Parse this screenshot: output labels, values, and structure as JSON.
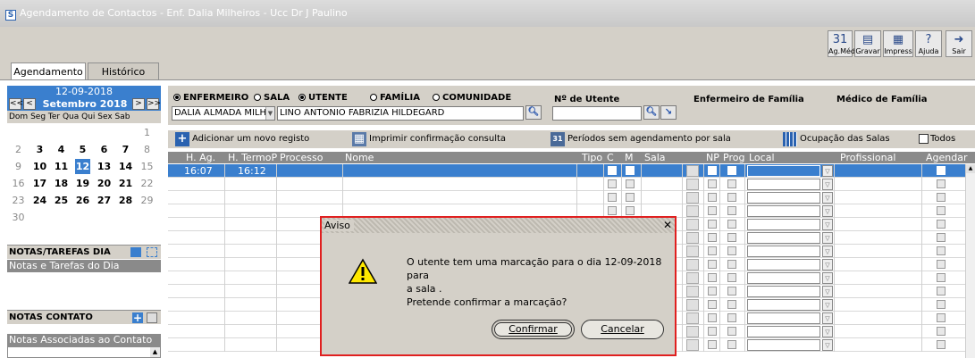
{
  "window": {
    "title": "Agendamento de Contactos - Enf. Dalia Milheiros - Ucc Dr J Paulino",
    "logo_letter": "S"
  },
  "toolbar": [
    {
      "name": "ag-med-button",
      "label": "Ag.Méd.",
      "icon": "calendar-icon",
      "glyph": "31"
    },
    {
      "name": "gravar-button",
      "label": "Gravar",
      "icon": "save-icon",
      "glyph": "▤"
    },
    {
      "name": "impress-button",
      "label": "Impress",
      "icon": "printer-icon",
      "glyph": "▦"
    },
    {
      "name": "ajuda-button",
      "label": "Ajuda",
      "icon": "help-icon",
      "glyph": "?"
    },
    {
      "name": "sair-button",
      "label": "Sair",
      "icon": "exit-icon",
      "glyph": "➜"
    }
  ],
  "tabs": [
    {
      "label": "Agendamento",
      "active": true
    },
    {
      "label": "Histórico",
      "active": false
    }
  ],
  "calendar": {
    "date": "12-09-2018",
    "month": "Setembro 2018",
    "nav": {
      "prev_year": "<<",
      "prev": "<",
      "next": ">",
      "next_year": ">>"
    },
    "weekdays": "Dom Seg Ter Qua Qui Sex Sab",
    "days": [
      {
        "d": "1",
        "row": 0,
        "col": 6,
        "dim": true
      },
      {
        "d": "2",
        "row": 1,
        "col": 0,
        "dim": true
      },
      {
        "d": "3",
        "row": 1,
        "col": 1
      },
      {
        "d": "4",
        "row": 1,
        "col": 2
      },
      {
        "d": "5",
        "row": 1,
        "col": 3
      },
      {
        "d": "6",
        "row": 1,
        "col": 4
      },
      {
        "d": "7",
        "row": 1,
        "col": 5
      },
      {
        "d": "8",
        "row": 1,
        "col": 6,
        "dim": true
      },
      {
        "d": "9",
        "row": 2,
        "col": 0,
        "dim": true
      },
      {
        "d": "10",
        "row": 2,
        "col": 1
      },
      {
        "d": "11",
        "row": 2,
        "col": 2
      },
      {
        "d": "12",
        "row": 2,
        "col": 3,
        "selected": true
      },
      {
        "d": "13",
        "row": 2,
        "col": 4
      },
      {
        "d": "14",
        "row": 2,
        "col": 5
      },
      {
        "d": "15",
        "row": 2,
        "col": 6,
        "dim": true
      },
      {
        "d": "16",
        "row": 3,
        "col": 0,
        "dim": true
      },
      {
        "d": "17",
        "row": 3,
        "col": 1
      },
      {
        "d": "18",
        "row": 3,
        "col": 2
      },
      {
        "d": "19",
        "row": 3,
        "col": 3
      },
      {
        "d": "20",
        "row": 3,
        "col": 4
      },
      {
        "d": "21",
        "row": 3,
        "col": 5
      },
      {
        "d": "22",
        "row": 3,
        "col": 6,
        "dim": true
      },
      {
        "d": "23",
        "row": 4,
        "col": 0,
        "dim": true
      },
      {
        "d": "24",
        "row": 4,
        "col": 1
      },
      {
        "d": "25",
        "row": 4,
        "col": 2
      },
      {
        "d": "26",
        "row": 4,
        "col": 3
      },
      {
        "d": "27",
        "row": 4,
        "col": 4
      },
      {
        "d": "28",
        "row": 4,
        "col": 5
      },
      {
        "d": "29",
        "row": 4,
        "col": 6,
        "dim": true
      },
      {
        "d": "30",
        "row": 5,
        "col": 0,
        "dim": true
      }
    ]
  },
  "notes_tasks": {
    "heading": "NOTAS/TAREFAS DIA",
    "sub": "Notas e Tarefas do Dia"
  },
  "notes_contact": {
    "heading": "NOTAS CONTATO",
    "sub": "Notas Associadas ao Contato"
  },
  "filters": {
    "radio_enfermeiro": "ENFERMEIRO",
    "radio_sala": "SALA",
    "radio_utente": "UTENTE",
    "radio_familia": "FAMÍLIA",
    "radio_comunidade": "COMUNIDADE",
    "enfermeiro_value": "DALIA ALMADA MILHEIR...",
    "utente_value": "LINO ANTONIO FABRIZIA HILDEGARD",
    "n_utente_label": "Nº de Utente",
    "n_utente_value": "",
    "enf_familia_label": "Enfermeiro de Família",
    "med_familia_label": "Médico de Família"
  },
  "actions": {
    "add": "Adicionar um novo registo",
    "print": "Imprimir confirmação consulta",
    "periods": "Períodos sem agendamento por sala",
    "rooms": "Ocupação das Salas",
    "all": "Todos"
  },
  "grid": {
    "columns": [
      "H. Ag.",
      "H. TermoP",
      "Processo",
      "Nome",
      "Tipo",
      "C",
      "M",
      "Sala",
      "NP",
      "Prog",
      "Local",
      "Profissional",
      "Agendar"
    ],
    "rows": [
      {
        "h_ag": "16:07",
        "h_termo": "16:12",
        "processo": "",
        "nome": "",
        "tipo": "",
        "sala": "",
        "local": "",
        "profissional": "",
        "selected": true
      }
    ],
    "empty_rows": 13
  },
  "dialog": {
    "title": "Aviso",
    "close": "✕",
    "icon": "warning-icon",
    "message_lines": [
      "O utente tem uma marcação para o dia 12-09-2018 para",
      "a sala .",
      "Pretende confirmar a marcação?"
    ],
    "confirm_label": "Confirmar",
    "cancel_label": "Cancelar"
  }
}
